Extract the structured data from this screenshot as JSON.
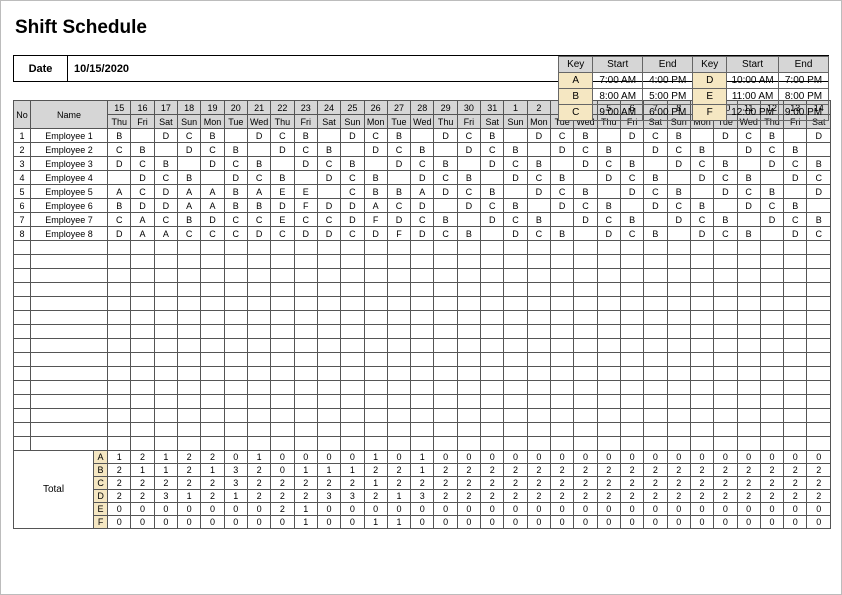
{
  "title": "Shift Schedule",
  "date_label": "Date",
  "date_value": "10/15/2020",
  "key_header": {
    "key": "Key",
    "start": "Start",
    "end": "End"
  },
  "keys": [
    {
      "code": "A",
      "start": "7:00 AM",
      "end": "4:00 PM"
    },
    {
      "code": "B",
      "start": "8:00 AM",
      "end": "5:00 PM"
    },
    {
      "code": "C",
      "start": "9:00 AM",
      "end": "6:00 PM"
    },
    {
      "code": "D",
      "start": "10:00 AM",
      "end": "7:00 PM"
    },
    {
      "code": "E",
      "start": "11:00 AM",
      "end": "8:00 PM"
    },
    {
      "code": "F",
      "start": "12:00 PM",
      "end": "9:00 PM"
    }
  ],
  "schedule_headers": {
    "no": "No",
    "name": "Name"
  },
  "day_nums": [
    "15",
    "16",
    "17",
    "18",
    "19",
    "20",
    "21",
    "22",
    "23",
    "24",
    "25",
    "26",
    "27",
    "28",
    "29",
    "30",
    "31",
    "1",
    "2",
    "3",
    "4",
    "5",
    "6",
    "7",
    "8",
    "9",
    "10",
    "11",
    "12",
    "13",
    "14"
  ],
  "day_names": [
    "Thu",
    "Fri",
    "Sat",
    "Sun",
    "Mon",
    "Tue",
    "Wed",
    "Thu",
    "Fri",
    "Sat",
    "Sun",
    "Mon",
    "Tue",
    "Wed",
    "Thu",
    "Fri",
    "Sat",
    "Sun",
    "Mon",
    "Tue",
    "Wed",
    "Thu",
    "Fri",
    "Sat",
    "Sun",
    "Mon",
    "Tue",
    "Wed",
    "Thu",
    "Fri",
    "Sat"
  ],
  "employees": [
    {
      "no": "1",
      "name": "Employee 1",
      "shifts": [
        "B",
        "",
        "D",
        "C",
        "B",
        "",
        "D",
        "C",
        "B",
        "",
        "D",
        "C",
        "B",
        "",
        "D",
        "C",
        "B",
        "",
        "D",
        "C",
        "B",
        "",
        "D",
        "C",
        "B",
        "",
        "D",
        "C",
        "B",
        "",
        "D"
      ]
    },
    {
      "no": "2",
      "name": "Employee 2",
      "shifts": [
        "C",
        "B",
        "",
        "D",
        "C",
        "B",
        "",
        "D",
        "C",
        "B",
        "",
        "D",
        "C",
        "B",
        "",
        "D",
        "C",
        "B",
        "",
        "D",
        "C",
        "B",
        "",
        "D",
        "C",
        "B",
        "",
        "D",
        "C",
        "B",
        ""
      ]
    },
    {
      "no": "3",
      "name": "Employee 3",
      "shifts": [
        "D",
        "C",
        "B",
        "",
        "D",
        "C",
        "B",
        "",
        "D",
        "C",
        "B",
        "",
        "D",
        "C",
        "B",
        "",
        "D",
        "C",
        "B",
        "",
        "D",
        "C",
        "B",
        "",
        "D",
        "C",
        "B",
        "",
        "D",
        "C",
        "B"
      ]
    },
    {
      "no": "4",
      "name": "Employee 4",
      "shifts": [
        "",
        "D",
        "C",
        "B",
        "",
        "D",
        "C",
        "B",
        "",
        "D",
        "C",
        "B",
        "",
        "D",
        "C",
        "B",
        "",
        "D",
        "C",
        "B",
        "",
        "D",
        "C",
        "B",
        "",
        "D",
        "C",
        "B",
        "",
        "D",
        "C"
      ]
    },
    {
      "no": "5",
      "name": "Employee 5",
      "shifts": [
        "A",
        "C",
        "D",
        "A",
        "A",
        "B",
        "A",
        "E",
        "E",
        "",
        "C",
        "B",
        "B",
        "A",
        "D",
        "C",
        "B",
        "",
        "D",
        "C",
        "B",
        "",
        "D",
        "C",
        "B",
        "",
        "D",
        "C",
        "B",
        "",
        "D"
      ]
    },
    {
      "no": "6",
      "name": "Employee 6",
      "shifts": [
        "B",
        "D",
        "D",
        "A",
        "A",
        "B",
        "B",
        "D",
        "F",
        "D",
        "D",
        "A",
        "C",
        "D",
        "",
        "D",
        "C",
        "B",
        "",
        "D",
        "C",
        "B",
        "",
        "D",
        "C",
        "B",
        "",
        "D",
        "C",
        "B",
        ""
      ]
    },
    {
      "no": "7",
      "name": "Employee 7",
      "shifts": [
        "C",
        "A",
        "C",
        "B",
        "D",
        "C",
        "C",
        "E",
        "C",
        "C",
        "D",
        "F",
        "D",
        "C",
        "B",
        "",
        "D",
        "C",
        "B",
        "",
        "D",
        "C",
        "B",
        "",
        "D",
        "C",
        "B",
        "",
        "D",
        "C",
        "B"
      ]
    },
    {
      "no": "8",
      "name": "Employee 8",
      "shifts": [
        "D",
        "A",
        "A",
        "C",
        "C",
        "C",
        "D",
        "C",
        "D",
        "D",
        "C",
        "D",
        "F",
        "D",
        "C",
        "B",
        "",
        "D",
        "C",
        "B",
        "",
        "D",
        "C",
        "B",
        "",
        "D",
        "C",
        "B",
        "",
        "D",
        "C"
      ]
    }
  ],
  "empty_rows": 15,
  "total_label": "Total",
  "total_keys": [
    "A",
    "B",
    "C",
    "D",
    "E",
    "F"
  ],
  "totals": {
    "A": [
      "1",
      "2",
      "1",
      "2",
      "2",
      "0",
      "1",
      "0",
      "0",
      "0",
      "0",
      "1",
      "0",
      "1",
      "0",
      "0",
      "0",
      "0",
      "0",
      "0",
      "0",
      "0",
      "0",
      "0",
      "0",
      "0",
      "0",
      "0",
      "0",
      "0",
      "0"
    ],
    "B": [
      "2",
      "1",
      "1",
      "2",
      "1",
      "3",
      "2",
      "0",
      "1",
      "1",
      "1",
      "2",
      "2",
      "1",
      "2",
      "2",
      "2",
      "2",
      "2",
      "2",
      "2",
      "2",
      "2",
      "2",
      "2",
      "2",
      "2",
      "2",
      "2",
      "2",
      "2"
    ],
    "C": [
      "2",
      "2",
      "2",
      "2",
      "2",
      "3",
      "2",
      "2",
      "2",
      "2",
      "2",
      "1",
      "2",
      "2",
      "2",
      "2",
      "2",
      "2",
      "2",
      "2",
      "2",
      "2",
      "2",
      "2",
      "2",
      "2",
      "2",
      "2",
      "2",
      "2",
      "2"
    ],
    "D": [
      "2",
      "2",
      "3",
      "1",
      "2",
      "1",
      "2",
      "2",
      "2",
      "3",
      "3",
      "2",
      "1",
      "3",
      "2",
      "2",
      "2",
      "2",
      "2",
      "2",
      "2",
      "2",
      "2",
      "2",
      "2",
      "2",
      "2",
      "2",
      "2",
      "2",
      "2"
    ],
    "E": [
      "0",
      "0",
      "0",
      "0",
      "0",
      "0",
      "0",
      "2",
      "1",
      "0",
      "0",
      "0",
      "0",
      "0",
      "0",
      "0",
      "0",
      "0",
      "0",
      "0",
      "0",
      "0",
      "0",
      "0",
      "0",
      "0",
      "0",
      "0",
      "0",
      "0",
      "0"
    ],
    "F": [
      "0",
      "0",
      "0",
      "0",
      "0",
      "0",
      "0",
      "0",
      "1",
      "0",
      "0",
      "1",
      "1",
      "0",
      "0",
      "0",
      "0",
      "0",
      "0",
      "0",
      "0",
      "0",
      "0",
      "0",
      "0",
      "0",
      "0",
      "0",
      "0",
      "0",
      "0"
    ]
  }
}
